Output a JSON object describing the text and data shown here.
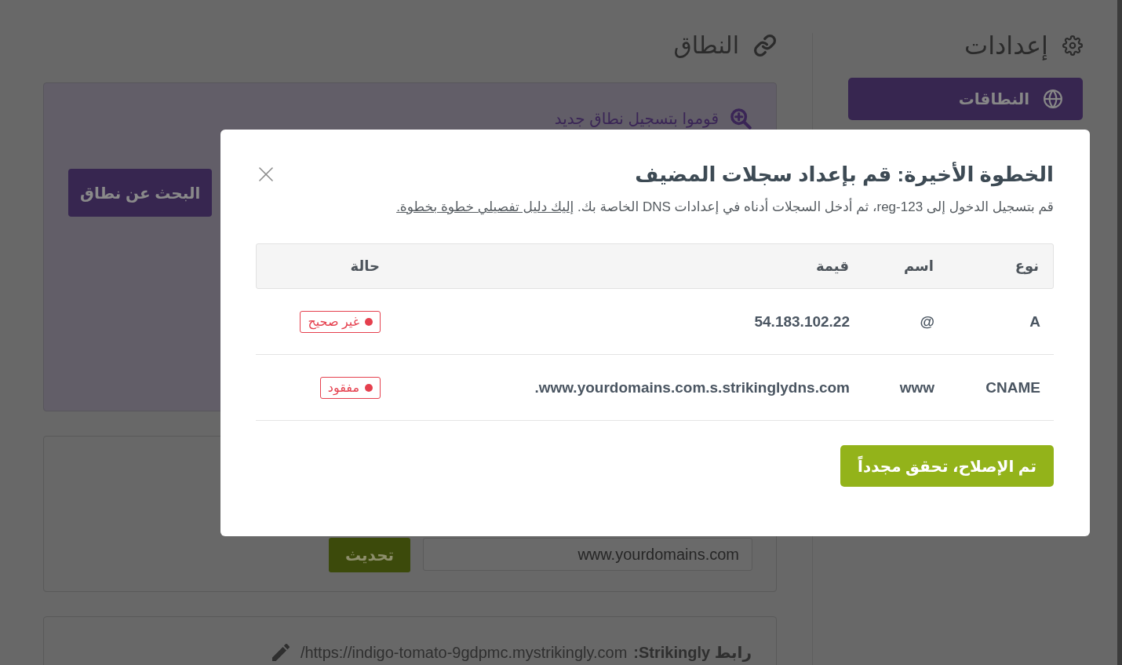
{
  "sidebar": {
    "title": "إعدادات",
    "items": [
      {
        "label": "النطاقات",
        "selected": true
      }
    ]
  },
  "main": {
    "title": "النطاق",
    "register_card": {
      "link": "قوموا بتسجيل نطاق جديد",
      "button": "البحث عن نطاق"
    },
    "domain_card": {
      "value": "www.yourdomains.com",
      "button": "تحديث"
    },
    "site_card": {
      "label": "رابط Strikingly:",
      "url": "https://indigo-tomato-9gdpmc.mystrikingly.com/"
    }
  },
  "modal": {
    "title": "الخطوة الأخيرة: قم بإعداد سجلات المضيف",
    "text": "قم بتسجيل الدخول إلى reg-123، ثم أدخل السجلات أدناه في إعدادات DNS الخاصة بك.",
    "link": "إليك دليل تفصيلي خطوة بخطوة.",
    "table": {
      "columns": [
        "نوع",
        "اسم",
        "قيمة",
        "حالة"
      ],
      "rows": [
        {
          "type": "A",
          "name": "@",
          "value": "54.183.102.22",
          "status": "غير صحيح"
        },
        {
          "type": "CNAME",
          "name": "www",
          "value": "www.yourdomains.com.s.strikinglydns.com.",
          "status": "مفقود"
        }
      ]
    },
    "button": "تم الإصلاح، تحقق مجدداً"
  }
}
